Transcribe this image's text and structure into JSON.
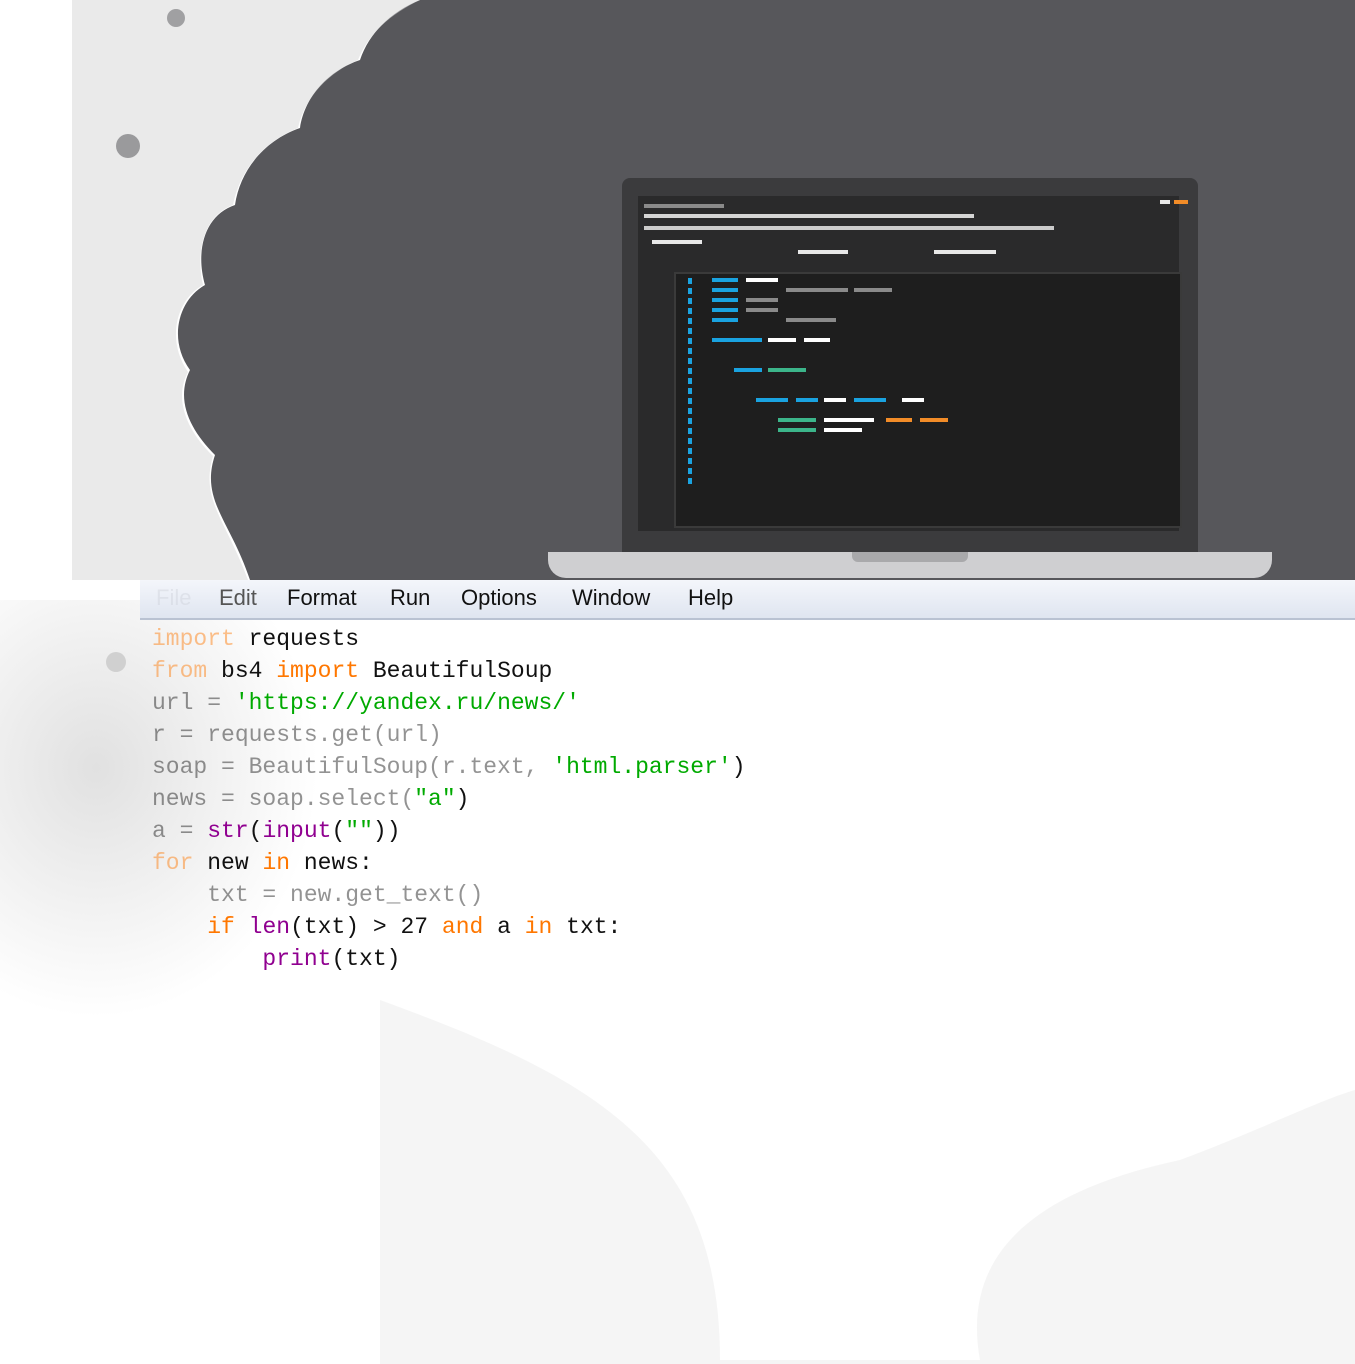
{
  "menubar": {
    "items": [
      "File",
      "Edit",
      "Format",
      "Run",
      "Options",
      "Window",
      "Help"
    ]
  },
  "code": {
    "lines": [
      [
        {
          "t": "import",
          "c": "kw"
        },
        {
          "t": " requests",
          "c": ""
        }
      ],
      [
        {
          "t": "from",
          "c": "kw"
        },
        {
          "t": " bs4 ",
          "c": ""
        },
        {
          "t": "import",
          "c": "kw"
        },
        {
          "t": " BeautifulSoup",
          "c": ""
        }
      ],
      [
        {
          "t": "url = ",
          "c": ""
        },
        {
          "t": "'https://yandex.ru/news/'",
          "c": "st"
        }
      ],
      [
        {
          "t": "r = requests.get(url)",
          "c": ""
        }
      ],
      [
        {
          "t": "soap = BeautifulSoup(r.text, ",
          "c": ""
        },
        {
          "t": "'html.parser'",
          "c": "st"
        },
        {
          "t": ")",
          "c": ""
        }
      ],
      [
        {
          "t": "news = soap.select(",
          "c": ""
        },
        {
          "t": "\"a\"",
          "c": "st"
        },
        {
          "t": ")",
          "c": ""
        }
      ],
      [
        {
          "t": "a = ",
          "c": ""
        },
        {
          "t": "str",
          "c": "bi"
        },
        {
          "t": "(",
          "c": ""
        },
        {
          "t": "input",
          "c": "bi"
        },
        {
          "t": "(",
          "c": ""
        },
        {
          "t": "\"\"",
          "c": "st"
        },
        {
          "t": "))",
          "c": ""
        }
      ],
      [
        {
          "t": "for",
          "c": "kw"
        },
        {
          "t": " new ",
          "c": ""
        },
        {
          "t": "in",
          "c": "kw"
        },
        {
          "t": " news:",
          "c": ""
        }
      ],
      [
        {
          "t": "    txt = new.get_text()",
          "c": ""
        }
      ],
      [
        {
          "t": "    ",
          "c": ""
        },
        {
          "t": "if",
          "c": "kw"
        },
        {
          "t": " ",
          "c": ""
        },
        {
          "t": "len",
          "c": "bi"
        },
        {
          "t": "(txt) > 27 ",
          "c": ""
        },
        {
          "t": "and",
          "c": "kw"
        },
        {
          "t": " a ",
          "c": ""
        },
        {
          "t": "in",
          "c": "kw"
        },
        {
          "t": " txt:",
          "c": ""
        }
      ],
      [
        {
          "t": "        ",
          "c": ""
        },
        {
          "t": "print",
          "c": "bi"
        },
        {
          "t": "(txt)",
          "c": ""
        }
      ]
    ]
  },
  "colors": {
    "keyword": "#ff7700",
    "string": "#00aa00",
    "builtin": "#900090",
    "laptop_bg": "#57575b"
  }
}
